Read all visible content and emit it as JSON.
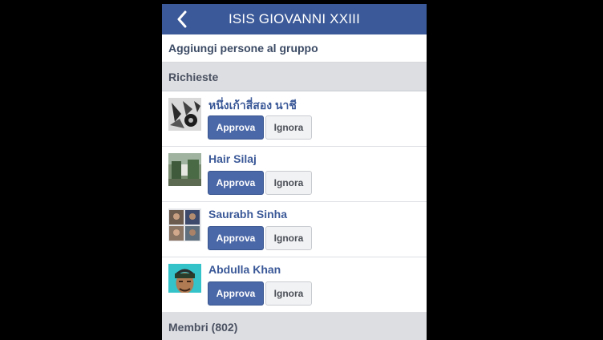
{
  "header": {
    "title": "ISIS GIOVANNI XXIII",
    "back_icon": "chevron-left-icon",
    "bg_color": "#3b5998"
  },
  "add_people": {
    "label": "Aggiungi persone al gruppo"
  },
  "requests": {
    "section_label": "Richieste",
    "items": [
      {
        "name": "หนึ่งเก้าสี่สอง นาชี",
        "approve_label": "Approva",
        "ignore_label": "Ignora"
      },
      {
        "name": "Hair Silaj",
        "approve_label": "Approva",
        "ignore_label": "Ignora"
      },
      {
        "name": "Saurabh Sinha",
        "approve_label": "Approva",
        "ignore_label": "Ignora"
      },
      {
        "name": "Abdulla Khan",
        "approve_label": "Approva",
        "ignore_label": "Ignora"
      }
    ]
  },
  "members": {
    "section_label": "Membri (802)"
  }
}
